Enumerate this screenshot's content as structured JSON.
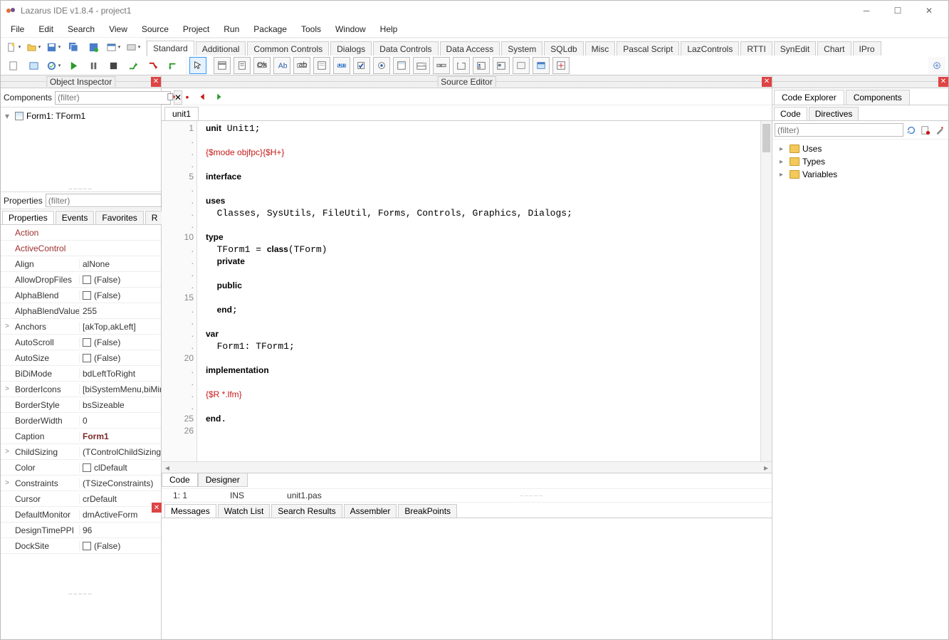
{
  "titlebar": {
    "text": "Lazarus IDE v1.8.4 - project1"
  },
  "menu": [
    "File",
    "Edit",
    "Search",
    "View",
    "Source",
    "Project",
    "Run",
    "Package",
    "Tools",
    "Window",
    "Help"
  ],
  "palette_tabs": [
    "Standard",
    "Additional",
    "Common Controls",
    "Dialogs",
    "Data Controls",
    "Data Access",
    "System",
    "SQLdb",
    "Misc",
    "Pascal Script",
    "LazControls",
    "RTTI",
    "SynEdit",
    "Chart",
    "IPro"
  ],
  "palette_selected": "Standard",
  "panels": {
    "object_inspector": "Object Inspector",
    "source_editor": "Source Editor",
    "code_explorer": "Code Explorer"
  },
  "oi": {
    "components_label": "Components",
    "filter_placeholder": "(filter)",
    "tree_item": "Form1: TForm1",
    "props_label": "Properties",
    "tabs": [
      "Properties",
      "Events",
      "Favorites",
      "Restricted"
    ],
    "selected_tab": "Properties",
    "rows": [
      {
        "exp": "",
        "name": "Action",
        "val": "",
        "red": true
      },
      {
        "exp": "",
        "name": "ActiveControl",
        "val": "",
        "red": true
      },
      {
        "exp": "",
        "name": "Align",
        "val": "alNone"
      },
      {
        "exp": "",
        "name": "AllowDropFiles",
        "val": "(False)",
        "cb": true
      },
      {
        "exp": "",
        "name": "AlphaBlend",
        "val": "(False)",
        "cb": true
      },
      {
        "exp": "",
        "name": "AlphaBlendValue",
        "val": "255"
      },
      {
        "exp": ">",
        "name": "Anchors",
        "val": "[akTop,akLeft]"
      },
      {
        "exp": "",
        "name": "AutoScroll",
        "val": "(False)",
        "cb": true
      },
      {
        "exp": "",
        "name": "AutoSize",
        "val": "(False)",
        "cb": true
      },
      {
        "exp": "",
        "name": "BiDiMode",
        "val": "bdLeftToRight"
      },
      {
        "exp": ">",
        "name": "BorderIcons",
        "val": "[biSystemMenu,biMinimize,biMaximize]"
      },
      {
        "exp": "",
        "name": "BorderStyle",
        "val": "bsSizeable"
      },
      {
        "exp": "",
        "name": "BorderWidth",
        "val": "0"
      },
      {
        "exp": "",
        "name": "Caption",
        "val": "Form1",
        "bold": true
      },
      {
        "exp": ">",
        "name": "ChildSizing",
        "val": "(TControlChildSizing)"
      },
      {
        "exp": "",
        "name": "Color",
        "val": "clDefault",
        "cb": true
      },
      {
        "exp": ">",
        "name": "Constraints",
        "val": "(TSizeConstraints)"
      },
      {
        "exp": "",
        "name": "Cursor",
        "val": "crDefault"
      },
      {
        "exp": "",
        "name": "DefaultMonitor",
        "val": "dmActiveForm"
      },
      {
        "exp": "",
        "name": "DesignTimePPI",
        "val": "96"
      },
      {
        "exp": "",
        "name": "DockSite",
        "val": "(False)",
        "cb": true
      }
    ]
  },
  "source": {
    "tab": "unit1",
    "gutter": [
      "1",
      ".",
      ".",
      ".",
      "5",
      ".",
      ".",
      ".",
      ".",
      "10",
      ".",
      ".",
      ".",
      ".",
      "15",
      ".",
      ".",
      ".",
      ".",
      "20",
      ".",
      ".",
      ".",
      ".",
      "25",
      "26"
    ],
    "bottom_tabs": [
      "Code",
      "Designer"
    ],
    "bottom_selected": "Code"
  },
  "status": {
    "pos": "1:   1",
    "mode": "INS",
    "file": "unit1.pas"
  },
  "msg_tabs": [
    "Messages",
    "Watch List",
    "Search Results",
    "Assembler",
    "BreakPoints"
  ],
  "msg_selected": "Messages",
  "ce": {
    "top_tabs": [
      "Code Explorer",
      "Components"
    ],
    "top_selected": "Code Explorer",
    "sub_tabs": [
      "Code",
      "Directives"
    ],
    "sub_selected": "Code",
    "filter_placeholder": "(filter)",
    "items": [
      "Uses",
      "Types",
      "Variables"
    ]
  }
}
